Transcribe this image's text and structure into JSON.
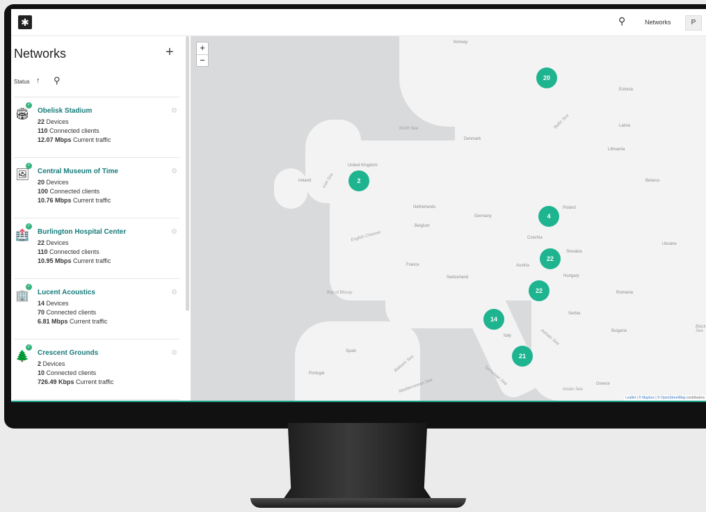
{
  "topbar": {
    "nav_label": "Networks",
    "avatar_initial": "P"
  },
  "sidebar": {
    "title": "Networks",
    "sort_label": "Status",
    "items": [
      {
        "name": "Obelisk Stadium",
        "devices": "22",
        "devices_label": "Devices",
        "clients": "110",
        "clients_label": "Connected clients",
        "traffic": "12.07 Mbps",
        "traffic_label": "Current traffic"
      },
      {
        "name": "Central Museum of Time",
        "devices": "20",
        "devices_label": "Devices",
        "clients": "100",
        "clients_label": "Connected clients",
        "traffic": "10.76 Mbps",
        "traffic_label": "Current traffic"
      },
      {
        "name": "Burlington Hospital Center",
        "devices": "22",
        "devices_label": "Devices",
        "clients": "110",
        "clients_label": "Connected clients",
        "traffic": "10.95 Mbps",
        "traffic_label": "Current traffic"
      },
      {
        "name": "Lucent Acoustics",
        "devices": "14",
        "devices_label": "Devices",
        "clients": "70",
        "clients_label": "Connected clients",
        "traffic": "6.81 Mbps",
        "traffic_label": "Current traffic"
      },
      {
        "name": "Crescent Grounds",
        "devices": "2",
        "devices_label": "Devices",
        "clients": "10",
        "clients_label": "Connected clients",
        "traffic": "726.49 Kbps",
        "traffic_label": "Current traffic"
      }
    ]
  },
  "map": {
    "zoom_in": "+",
    "zoom_out": "−",
    "clusters": [
      "20",
      "2",
      "4",
      "22",
      "22",
      "14",
      "21"
    ],
    "labels": {
      "norway": "Norway",
      "ireland": "Ireland",
      "uk": "United Kingdom",
      "denmark": "Denmark",
      "netherlands": "Netherlands",
      "belgium": "Belgium",
      "germany": "Germany",
      "poland": "Poland",
      "czechia": "Czechia",
      "france": "France",
      "switzerland": "Switzerland",
      "austria": "Austria",
      "hungary": "Hungary",
      "slovakia": "Slovakia",
      "ukraine": "Ukraine",
      "belarus": "Belarus",
      "lithuania": "Lithuania",
      "latvia": "Latvia",
      "estonia": "Estonia",
      "romania": "Romania",
      "serbia": "Serbia",
      "italy": "Italy",
      "spain": "Spain",
      "portugal": "Portugal",
      "bulgaria": "Bulgaria",
      "greece": "Greece"
    },
    "seas": {
      "north_sea": "North Sea",
      "baltic": "Baltic Sea",
      "english_channel": "English Channel",
      "biscay": "Bay of Biscay",
      "irish_sea": "Irish Sea",
      "mediterranean": "Mediterranean Sea",
      "tyrrhenian": "Tyrrhenian Sea",
      "adriatic": "Adriatic Sea",
      "balearic": "Balearic Sea",
      "ionian": "Ionian Sea",
      "black": "Black Sea"
    },
    "attribution_leaflet": "Leaflet",
    "attribution_mapbox": "© Mapbox",
    "attribution_osm": "© OpenStreetMap",
    "attribution_contrib": "contributors"
  }
}
